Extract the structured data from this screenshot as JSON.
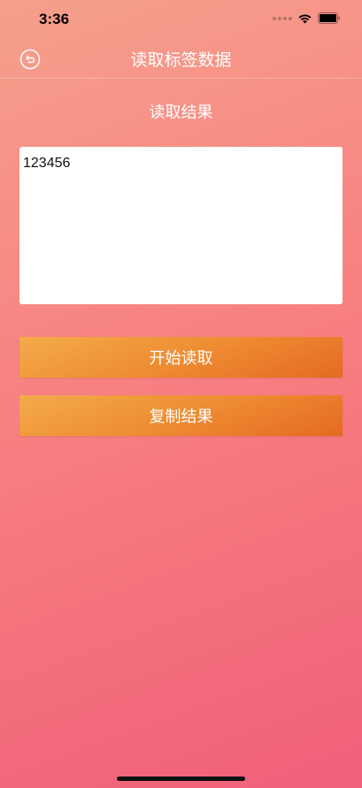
{
  "status_bar": {
    "time": "3:36"
  },
  "navbar": {
    "title": "读取标签数据",
    "back_icon": "back-arrow-circle-icon"
  },
  "main": {
    "section_title": "读取结果",
    "result_text": "123456",
    "start_button_label": "开始读取",
    "copy_button_label": "复制结果"
  },
  "colors": {
    "background_gradient_start": "#f6a08c",
    "background_gradient_end": "#f0607a",
    "button_gradient_start": "#f3ab4b",
    "button_gradient_end": "#e56a22"
  }
}
